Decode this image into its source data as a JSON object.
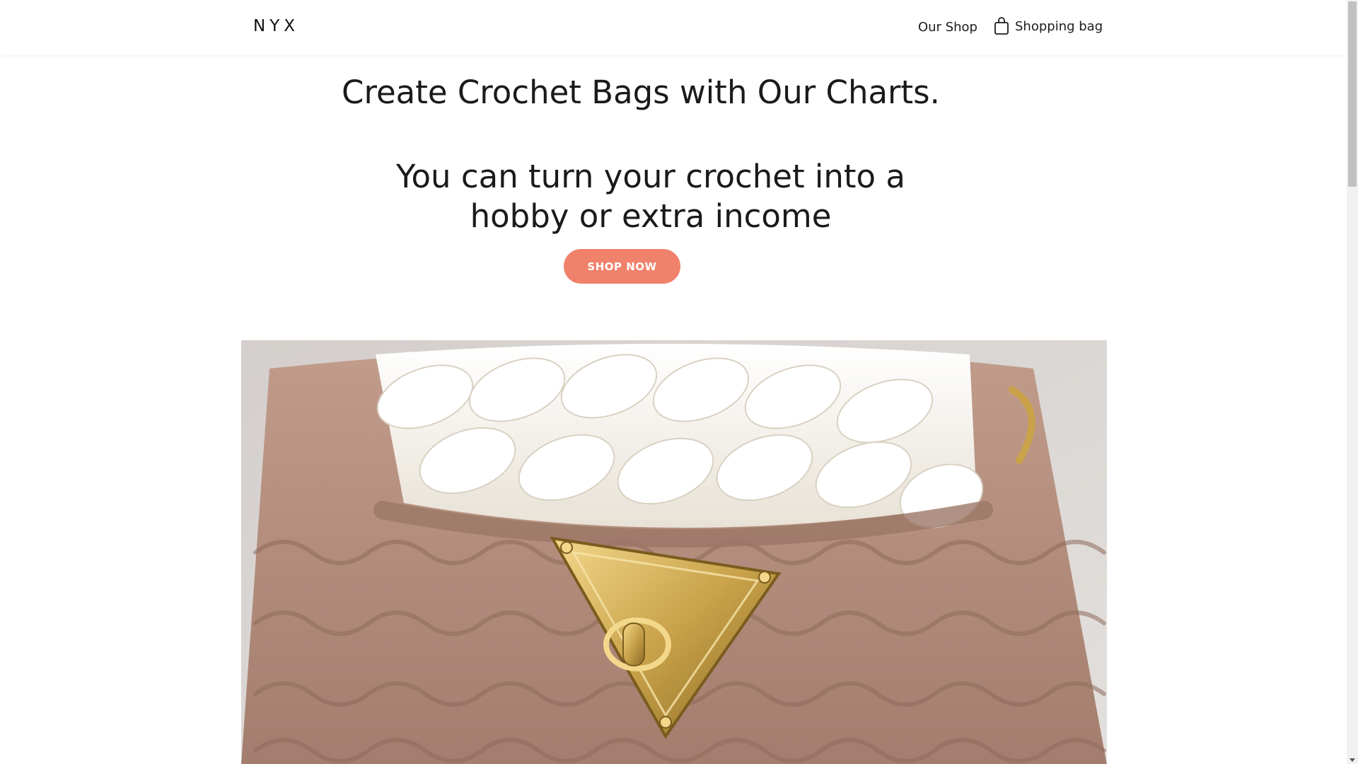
{
  "header": {
    "logo": "NYX",
    "nav_shop_label": "Our Shop",
    "bag_label": "Shopping bag",
    "bag_icon": "shopping-bag-icon"
  },
  "hero": {
    "title": "Create Crochet Bags with Our Charts.",
    "subtitle": "You can turn your crochet into a hobby or extra income",
    "cta_label": "SHOP NOW",
    "image_alt": "Crochet bag with gold clasp"
  },
  "colors": {
    "accent": "#f0816a",
    "text": "#1a1a1a",
    "background": "#ffffff",
    "yarn_tan": "#b48e7e",
    "yarn_cream": "#f4f0e8",
    "clasp_gold": "#c9a24a"
  }
}
